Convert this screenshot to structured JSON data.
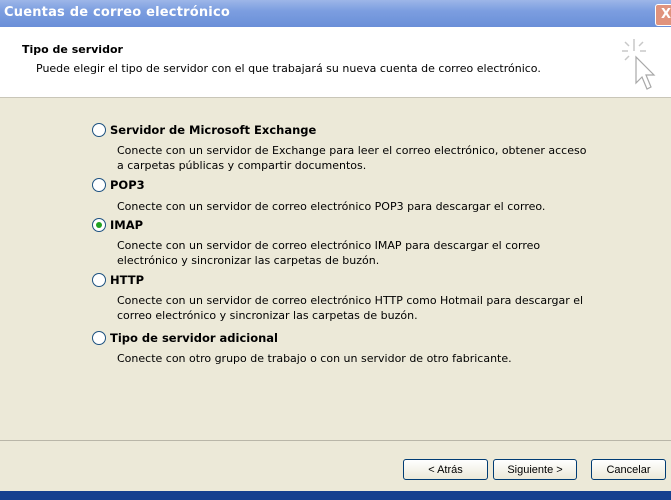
{
  "window": {
    "title": "Cuentas de correo electrónico",
    "close_glyph": "X"
  },
  "header": {
    "title": "Tipo de servidor",
    "subtitle": "Puede elegir el tipo de servidor con el que trabajará su nueva cuenta de correo electrónico."
  },
  "options": [
    {
      "label": "Servidor de Microsoft Exchange",
      "selected": false,
      "description": "Conecte con un servidor de Exchange para leer el correo electrónico, obtener acceso a carpetas públicas y compartir documentos."
    },
    {
      "label": "POP3",
      "selected": false,
      "description": "Conecte con un servidor de correo electrónico POP3 para descargar el correo."
    },
    {
      "label": "IMAP",
      "selected": true,
      "description": "Conecte con un servidor de correo electrónico IMAP para descargar el correo electrónico y sincronizar las carpetas de buzón."
    },
    {
      "label": "HTTP",
      "selected": false,
      "description": "Conecte con un servidor de correo electrónico HTTP como Hotmail para descargar el correo electrónico y sincronizar las carpetas de buzón."
    },
    {
      "label": "Tipo de servidor adicional",
      "selected": false,
      "description": "Conecte con otro grupo de trabajo o con un servidor de otro fabricante."
    }
  ],
  "buttons": {
    "back": "< Atrás",
    "next": "Siguiente >",
    "cancel": "Cancelar"
  }
}
